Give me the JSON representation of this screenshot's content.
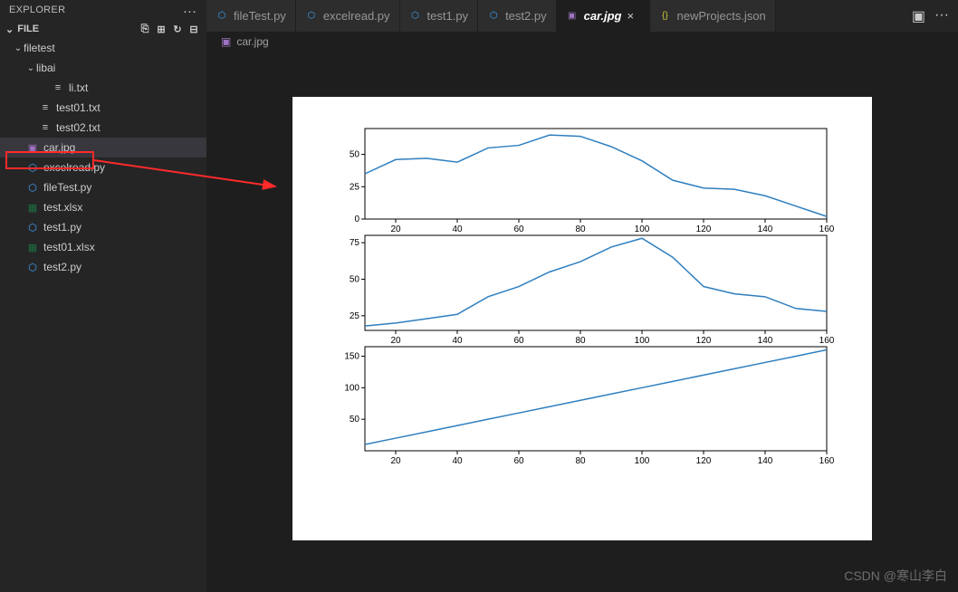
{
  "explorer": {
    "title": "EXPLORER",
    "section": "FILE",
    "dots": "..."
  },
  "tree": {
    "root": {
      "label": "filetest"
    },
    "folder1": {
      "label": "libai"
    },
    "items": {
      "li": "li.txt",
      "t01": "test01.txt",
      "t02": "test02.txt",
      "car": "car.jpg",
      "ex": "excelread.py",
      "ft": "fileTest.py",
      "xls": "test.xlsx",
      "t1": "test1.py",
      "t01x": "test01.xlsx",
      "t2": "test2.py"
    }
  },
  "tabs": [
    {
      "label": "fileTest.py",
      "icon": "py",
      "active": false
    },
    {
      "label": "excelread.py",
      "icon": "py",
      "active": false
    },
    {
      "label": "test1.py",
      "icon": "py",
      "active": false
    },
    {
      "label": "test2.py",
      "icon": "py",
      "active": false
    },
    {
      "label": "car.jpg",
      "icon": "img",
      "active": true,
      "close": "×",
      "italic": true
    },
    {
      "label": "newProjects.json",
      "icon": "json",
      "active": false
    }
  ],
  "breadcrumb": {
    "icon": "img",
    "label": "car.jpg"
  },
  "watermark": "CSDN @寒山李白",
  "chart_data": [
    {
      "type": "line",
      "x": [
        10,
        20,
        30,
        40,
        50,
        60,
        70,
        80,
        90,
        100,
        110,
        120,
        130,
        140,
        150,
        160
      ],
      "y": [
        35,
        46,
        47,
        44,
        55,
        57,
        65,
        64,
        56,
        45,
        30,
        24,
        23,
        18,
        10,
        2
      ],
      "xticks": [
        20,
        40,
        60,
        80,
        100,
        120,
        140,
        160
      ],
      "yticks": [
        0,
        25,
        50
      ],
      "ylim": [
        0,
        70
      ],
      "xlim": [
        10,
        160
      ]
    },
    {
      "type": "line",
      "x": [
        10,
        20,
        30,
        40,
        50,
        60,
        70,
        80,
        90,
        100,
        110,
        120,
        130,
        140,
        150,
        160
      ],
      "y": [
        18,
        20,
        23,
        26,
        38,
        45,
        55,
        62,
        72,
        78,
        65,
        45,
        40,
        38,
        30,
        28
      ],
      "xticks": [
        20,
        40,
        60,
        80,
        100,
        120,
        140,
        160
      ],
      "yticks": [
        25,
        50,
        75
      ],
      "ylim": [
        15,
        80
      ],
      "xlim": [
        10,
        160
      ]
    },
    {
      "type": "line",
      "x": [
        10,
        20,
        30,
        40,
        50,
        60,
        70,
        80,
        90,
        100,
        110,
        120,
        130,
        140,
        150,
        160
      ],
      "y": [
        10,
        20,
        30,
        40,
        50,
        60,
        70,
        80,
        90,
        100,
        110,
        120,
        130,
        140,
        150,
        160
      ],
      "xticks": [
        20,
        40,
        60,
        80,
        100,
        120,
        140,
        160
      ],
      "yticks": [
        50,
        100,
        150
      ],
      "ylim": [
        0,
        165
      ],
      "xlim": [
        10,
        160
      ]
    }
  ],
  "colors": {
    "line": "#2f7fbf",
    "highlight": "#ff2a2a"
  },
  "icons": {
    "newfile": "⎘",
    "newfolder": "⊞",
    "refresh": "↻",
    "collapse": "⊟",
    "split": "▣",
    "more": "···"
  }
}
